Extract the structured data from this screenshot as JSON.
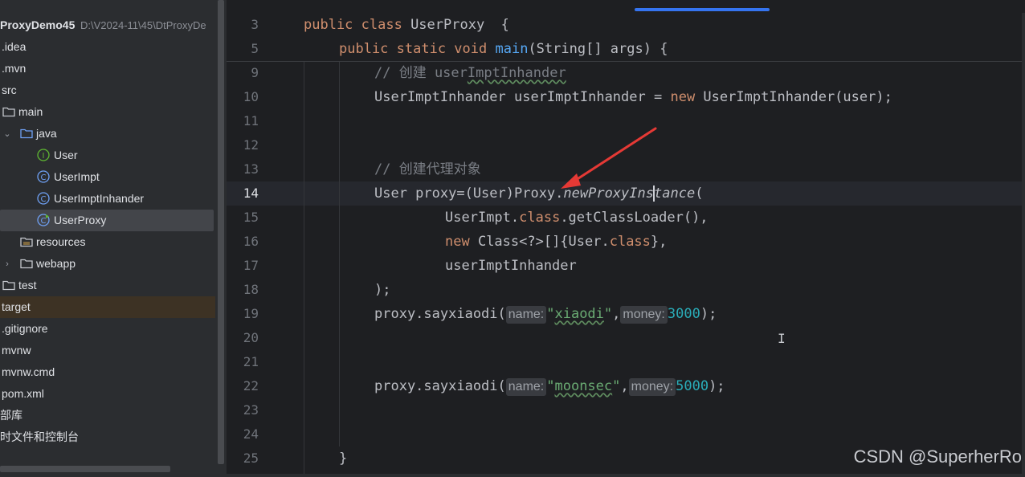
{
  "project": {
    "name": "ProxyDemo45",
    "path": "D:\\V2024-11\\45\\DtProxyDe",
    "items": [
      {
        "label": ".idea"
      },
      {
        "label": ".mvn"
      },
      {
        "label": "src"
      },
      {
        "label": "main"
      },
      {
        "label": "java"
      },
      {
        "label": "User",
        "icon": "interface-icon"
      },
      {
        "label": "UserImpt",
        "icon": "class-icon"
      },
      {
        "label": "UserImptInhander",
        "icon": "class-icon"
      },
      {
        "label": "UserProxy",
        "icon": "class-run-icon"
      },
      {
        "label": "resources"
      },
      {
        "label": "webapp"
      },
      {
        "label": "test"
      },
      {
        "label": "target"
      },
      {
        "label": ".gitignore"
      },
      {
        "label": "mvnw"
      },
      {
        "label": "mvnw.cmd"
      },
      {
        "label": "pom.xml"
      },
      {
        "label": "部库"
      },
      {
        "label": "时文件和控制台"
      }
    ]
  },
  "editor": {
    "active_line": "14",
    "lines": [
      {
        "n": "3"
      },
      {
        "n": "5"
      },
      {
        "n": "9"
      },
      {
        "n": "10"
      },
      {
        "n": "11"
      },
      {
        "n": "12"
      },
      {
        "n": "13"
      },
      {
        "n": "14"
      },
      {
        "n": "15"
      },
      {
        "n": "16"
      },
      {
        "n": "17"
      },
      {
        "n": "18"
      },
      {
        "n": "19"
      },
      {
        "n": "20"
      },
      {
        "n": "21"
      },
      {
        "n": "22"
      },
      {
        "n": "23"
      },
      {
        "n": "24"
      },
      {
        "n": "25"
      }
    ],
    "tokens": {
      "l3_kw": "public class",
      "l3_name": " UserProxy  {",
      "l5_kw": "public static void",
      "l5_fn": "main",
      "l5_rest": "(String[] args) {",
      "l9_cm": "// 创建 user",
      "l9_cm_wavy": "ImptInhander",
      "l10_a": "UserImptInhander userImptInhander = ",
      "l10_kw": "new",
      "l10_b": " UserImptInhander(user);",
      "l13_cm": "// 创建代理对象",
      "l14_a": "User proxy=(User)Proxy.",
      "l14_fn_a": "newProxyIns",
      "l14_fn_b": "tance",
      "l14_b": "(",
      "l15_a": "UserImpt.",
      "l15_kw": "class",
      "l15_b": ".getClassLoader(),",
      "l16_kw": "new",
      "l16_a": " Class<?>[]{User.",
      "l16_kw2": "class",
      "l16_b": "},",
      "l17_a": "userImptInhander",
      "l18_a": ");",
      "l19_a": "proxy.sayxiaodi(",
      "l19_hint1": "name:",
      "l19_str_q1": "\"",
      "l19_str": "xiaodi",
      "l19_str_q2": "\"",
      "l19_comma": ",",
      "l19_hint2": "money:",
      "l19_num": "3000",
      "l19_end": ");",
      "l22_a": "proxy.sayxiaodi(",
      "l22_hint1": "name:",
      "l22_str_q1": "\"",
      "l22_str": "moonsec",
      "l22_str_q2": "\"",
      "l22_comma": ",",
      "l22_hint2": "money:",
      "l22_num": "5000",
      "l22_end": ");",
      "l25_a": "}"
    },
    "annotation_color": "#e53935"
  },
  "watermark": "CSDN @SuperherRo",
  "colors": {
    "keyword": "#cf8e6d",
    "function": "#56a8f5",
    "string": "#6aab73",
    "number": "#2aacb8",
    "comment": "#7a7e85",
    "accent": "#3574f0"
  }
}
